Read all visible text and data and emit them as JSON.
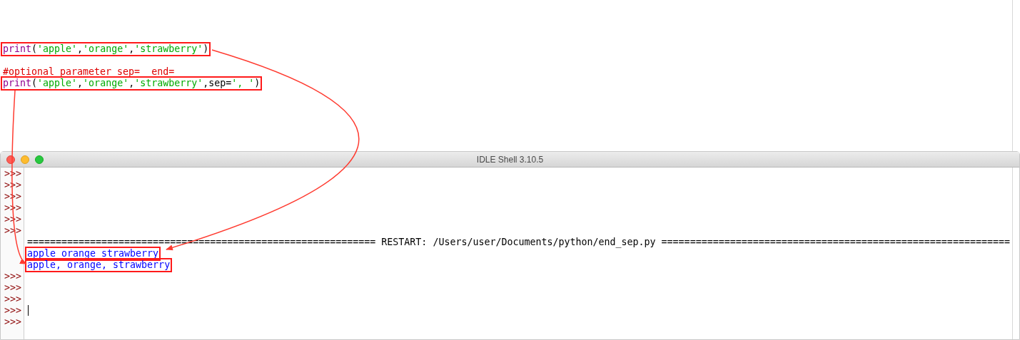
{
  "editor": {
    "lines": [
      {
        "kind": "code",
        "boxed": true,
        "tokens": [
          {
            "kind": "builtin",
            "text": "print"
          },
          {
            "kind": "plain",
            "text": "("
          },
          {
            "kind": "string",
            "text": "'apple'"
          },
          {
            "kind": "plain",
            "text": ","
          },
          {
            "kind": "string",
            "text": "'orange'"
          },
          {
            "kind": "plain",
            "text": ","
          },
          {
            "kind": "string",
            "text": "'strawberry'"
          },
          {
            "kind": "plain",
            "text": ")"
          }
        ]
      },
      {
        "kind": "blank"
      },
      {
        "kind": "code",
        "boxed": false,
        "tokens": [
          {
            "kind": "comment",
            "text": "#optional parameter sep=  end="
          }
        ]
      },
      {
        "kind": "code",
        "boxed": true,
        "tokens": [
          {
            "kind": "builtin",
            "text": "print"
          },
          {
            "kind": "plain",
            "text": "("
          },
          {
            "kind": "string",
            "text": "'apple'"
          },
          {
            "kind": "plain",
            "text": ","
          },
          {
            "kind": "string",
            "text": "'orange'"
          },
          {
            "kind": "plain",
            "text": ","
          },
          {
            "kind": "string",
            "text": "'strawberry'"
          },
          {
            "kind": "plain",
            "text": ",sep="
          },
          {
            "kind": "string",
            "text": "', '"
          },
          {
            "kind": "plain",
            "text": ")"
          }
        ]
      }
    ]
  },
  "shell": {
    "title": "IDLE Shell 3.10.5",
    "lines": [
      {
        "kind": "prompt",
        "prompt": ">>>",
        "cursor": false
      },
      {
        "kind": "prompt",
        "prompt": ">>>",
        "cursor": false
      },
      {
        "kind": "prompt",
        "prompt": ">>>",
        "cursor": false
      },
      {
        "kind": "prompt",
        "prompt": ">>>",
        "cursor": false
      },
      {
        "kind": "prompt",
        "prompt": ">>>",
        "cursor": false
      },
      {
        "kind": "prompt",
        "prompt": ">>>",
        "cursor": false
      },
      {
        "kind": "restart",
        "text": "============================================================= RESTART: /Users/user/Documents/python/end_sep.py ============================================================="
      },
      {
        "kind": "output",
        "text": "apple orange strawberry",
        "boxed": true
      },
      {
        "kind": "output",
        "text": "apple, orange, strawberry",
        "boxed": true
      },
      {
        "kind": "prompt",
        "prompt": ">>>",
        "cursor": false
      },
      {
        "kind": "prompt",
        "prompt": ">>>",
        "cursor": false
      },
      {
        "kind": "prompt",
        "prompt": ">>>",
        "cursor": false
      },
      {
        "kind": "prompt",
        "prompt": ">>>",
        "cursor": true
      },
      {
        "kind": "prompt",
        "prompt": ">>>",
        "cursor": false
      }
    ]
  }
}
